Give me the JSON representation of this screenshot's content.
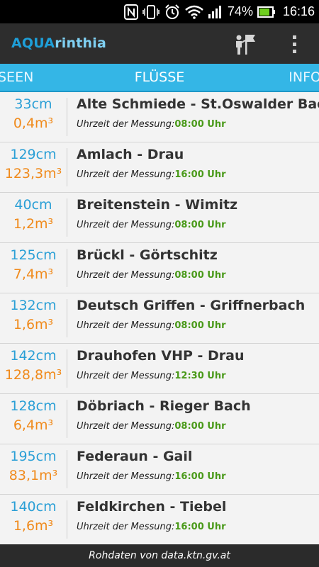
{
  "status": {
    "battery_percent": "74%",
    "time": "16:16"
  },
  "app": {
    "title_part1": "AQUA",
    "title_part2": "rinthia"
  },
  "tabs": {
    "left": "SEEN",
    "center": "FLÜSSE",
    "right": "INFO"
  },
  "list": {
    "time_label": "Uhrzeit der Messung:",
    "items": [
      {
        "level": "33cm",
        "flow": "0,4m³",
        "name": "Alte Schmiede - St.Oswalder Bach",
        "time": "08:00 Uhr"
      },
      {
        "level": "129cm",
        "flow": "123,3m³",
        "name": "Amlach - Drau",
        "time": "16:00 Uhr"
      },
      {
        "level": "40cm",
        "flow": "1,2m³",
        "name": "Breitenstein - Wimitz",
        "time": "08:00 Uhr"
      },
      {
        "level": "125cm",
        "flow": "7,4m³",
        "name": "Brückl - Görtschitz",
        "time": "08:00 Uhr"
      },
      {
        "level": "132cm",
        "flow": "1,6m³",
        "name": "Deutsch Griffen - Griffnerbach",
        "time": "08:00 Uhr"
      },
      {
        "level": "142cm",
        "flow": "128,8m³",
        "name": "Drauhofen VHP - Drau",
        "time": "12:30 Uhr"
      },
      {
        "level": "128cm",
        "flow": "6,4m³",
        "name": "Döbriach - Rieger Bach",
        "time": "08:00 Uhr"
      },
      {
        "level": "195cm",
        "flow": "83,1m³",
        "name": "Federaun - Gail",
        "time": "16:00 Uhr"
      },
      {
        "level": "140cm",
        "flow": "1,6m³",
        "name": "Feldkirchen - Tiebel",
        "time": "16:00 Uhr"
      }
    ]
  },
  "footer": {
    "text": "Rohdaten von data.ktn.gv.at"
  },
  "colors": {
    "accent_blue": "#34b6e6",
    "level_blue": "#2a9fd6",
    "flow_orange": "#f08a1b",
    "time_green": "#4a9a1a"
  },
  "icons": [
    "nfc-icon",
    "vibrate-icon",
    "alarm-icon",
    "wifi-icon",
    "signal-icon",
    "battery-icon",
    "map-flag-icon",
    "overflow-menu-icon"
  ]
}
